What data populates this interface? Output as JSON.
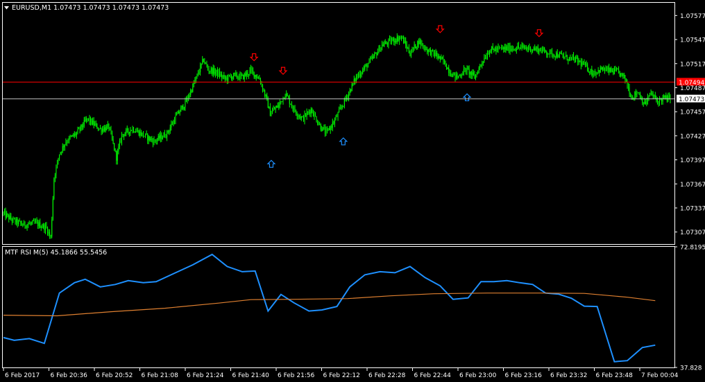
{
  "colors": {
    "background": "#000000",
    "foreground": "#ffffff",
    "bull": "#00ff00",
    "bear": "#00ff00",
    "bid_line": "#c0c0c0",
    "ask_line": "#ff0000",
    "rsi_fast": "#1e90ff",
    "rsi_slow": "#e08030",
    "sell_arrow": "#ff0000",
    "buy_arrow": "#1e90ff"
  },
  "header": {
    "symbol_line": "EURUSD,M1  1.07473 1.07473 1.07473 1.07473"
  },
  "indicator": {
    "label": "MTF RSI M(5) 45.1866 55.5456",
    "ymax_label": "72.8195",
    "ymin_label": "37.828"
  },
  "chart_data": [
    {
      "type": "candlestick",
      "symbol": "EURUSD",
      "timeframe": "M1",
      "ylim": [
        1.07292,
        1.07592
      ],
      "y_ticks": [
        "1.07577",
        "1.07547",
        "1.07517",
        "1.07487",
        "1.07457",
        "1.07427",
        "1.07397",
        "1.07367",
        "1.07337",
        "1.07307"
      ],
      "y_tick_values": [
        1.07577,
        1.07547,
        1.07517,
        1.07487,
        1.07457,
        1.07427,
        1.07397,
        1.07367,
        1.07337,
        1.07307
      ],
      "x_ticks": [
        "6 Feb 2017",
        "6 Feb 20:36",
        "6 Feb 20:52",
        "6 Feb 21:08",
        "6 Feb 21:24",
        "6 Feb 21:40",
        "6 Feb 21:56",
        "6 Feb 22:12",
        "6 Feb 22:28",
        "6 Feb 22:44",
        "6 Feb 23:00",
        "6 Feb 23:16",
        "6 Feb 23:32",
        "6 Feb 23:48",
        "7 Feb 00:04"
      ],
      "bid_price": 1.07473,
      "bid_label": "1.07473",
      "ask_price": 1.07494,
      "ask_label": "1.07494",
      "price_path": [
        [
          0,
          1.0733
        ],
        [
          8,
          1.07322
        ],
        [
          18,
          1.07316
        ],
        [
          30,
          1.07318
        ],
        [
          40,
          1.07312
        ],
        [
          44,
          1.073
        ],
        [
          47,
          1.07375
        ],
        [
          52,
          1.07405
        ],
        [
          58,
          1.0742
        ],
        [
          68,
          1.0743
        ],
        [
          78,
          1.07448
        ],
        [
          90,
          1.07435
        ],
        [
          98,
          1.07438
        ],
        [
          105,
          1.074
        ],
        [
          110,
          1.07428
        ],
        [
          120,
          1.07436
        ],
        [
          130,
          1.07428
        ],
        [
          140,
          1.0742
        ],
        [
          152,
          1.0743
        ],
        [
          160,
          1.0745
        ],
        [
          170,
          1.0747
        ],
        [
          178,
          1.07495
        ],
        [
          186,
          1.07522
        ],
        [
          190,
          1.0751
        ],
        [
          198,
          1.07506
        ],
        [
          206,
          1.07498
        ],
        [
          214,
          1.07502
        ],
        [
          222,
          1.075
        ],
        [
          230,
          1.07508
        ],
        [
          238,
          1.07498
        ],
        [
          244,
          1.07475
        ],
        [
          248,
          1.07455
        ],
        [
          256,
          1.07465
        ],
        [
          262,
          1.0748
        ],
        [
          270,
          1.0746
        ],
        [
          278,
          1.07448
        ],
        [
          286,
          1.0746
        ],
        [
          294,
          1.0744
        ],
        [
          300,
          1.0743
        ],
        [
          308,
          1.07446
        ],
        [
          314,
          1.07462
        ],
        [
          320,
          1.07478
        ],
        [
          328,
          1.075
        ],
        [
          336,
          1.07512
        ],
        [
          344,
          1.07525
        ],
        [
          352,
          1.0754
        ],
        [
          362,
          1.07546
        ],
        [
          370,
          1.0755
        ],
        [
          378,
          1.0753
        ],
        [
          386,
          1.07545
        ],
        [
          394,
          1.07534
        ],
        [
          402,
          1.07528
        ],
        [
          410,
          1.07518
        ],
        [
          416,
          1.07505
        ],
        [
          422,
          1.075
        ],
        [
          430,
          1.0751
        ],
        [
          438,
          1.075
        ],
        [
          446,
          1.07522
        ],
        [
          452,
          1.07534
        ],
        [
          460,
          1.07535
        ],
        [
          470,
          1.07536
        ],
        [
          480,
          1.07537
        ],
        [
          490,
          1.07536
        ],
        [
          500,
          1.07534
        ],
        [
          508,
          1.0753
        ],
        [
          516,
          1.07528
        ],
        [
          524,
          1.07524
        ],
        [
          532,
          1.07522
        ],
        [
          540,
          1.07515
        ],
        [
          548,
          1.07505
        ],
        [
          556,
          1.0751
        ],
        [
          564,
          1.07508
        ],
        [
          572,
          1.07506
        ],
        [
          578,
          1.07498
        ],
        [
          584,
          1.07475
        ],
        [
          590,
          1.07482
        ],
        [
          596,
          1.07466
        ],
        [
          602,
          1.0748
        ],
        [
          608,
          1.0747
        ],
        [
          614,
          1.07474
        ],
        [
          620,
          1.07473
        ]
      ],
      "sell_signals": [
        [
          233,
          1.07525
        ],
        [
          260,
          1.07508
        ],
        [
          406,
          1.0756
        ],
        [
          498,
          1.07555
        ]
      ],
      "buy_signals": [
        [
          249,
          1.07392
        ],
        [
          316,
          1.0742
        ],
        [
          431,
          1.07475
        ]
      ]
    },
    {
      "type": "line",
      "title": "MTF RSI M(5) 45.1866 55.5456",
      "ylim": [
        37.828,
        72.8195
      ],
      "y_ticks": [
        "72.8195",
        "37.828"
      ],
      "series": [
        {
          "values": [
            [
              0,
              46.5
            ],
            [
              10,
              45.7
            ],
            [
              24,
              46.2
            ],
            [
              38,
              44.8
            ],
            [
              52,
              59.4
            ],
            [
              66,
              62.4
            ],
            [
              76,
              63.4
            ],
            [
              90,
              61.2
            ],
            [
              104,
              61.9
            ],
            [
              116,
              63.0
            ],
            [
              130,
              62.4
            ],
            [
              142,
              62.7
            ],
            [
              160,
              65.3
            ],
            [
              176,
              67.6
            ],
            [
              194,
              70.6
            ],
            [
              208,
              67.1
            ],
            [
              222,
              65.6
            ],
            [
              234,
              65.8
            ],
            [
              246,
              54.2
            ],
            [
              258,
              59.0
            ],
            [
              270,
              56.6
            ],
            [
              284,
              54.2
            ],
            [
              296,
              54.5
            ],
            [
              310,
              55.5
            ],
            [
              322,
              61.2
            ],
            [
              336,
              64.7
            ],
            [
              350,
              65.6
            ],
            [
              364,
              65.3
            ],
            [
              378,
              67.1
            ],
            [
              392,
              63.9
            ],
            [
              406,
              61.5
            ],
            [
              418,
              57.6
            ],
            [
              432,
              58.0
            ],
            [
              444,
              62.7
            ],
            [
              456,
              62.7
            ],
            [
              468,
              63.0
            ],
            [
              480,
              62.4
            ],
            [
              492,
              61.9
            ],
            [
              504,
              59.4
            ],
            [
              516,
              59.1
            ],
            [
              528,
              57.9
            ],
            [
              540,
              55.6
            ],
            [
              552,
              55.5
            ],
            [
              568,
              39.5
            ],
            [
              580,
              39.8
            ],
            [
              594,
              43.6
            ],
            [
              606,
              44.3
            ]
          ]
        },
        {
          "values": [
            [
              0,
              53.0
            ],
            [
              50,
              52.8
            ],
            [
              100,
              54.0
            ],
            [
              150,
              55.0
            ],
            [
              200,
              56.5
            ],
            [
              230,
              57.5
            ],
            [
              270,
              57.6
            ],
            [
              320,
              57.8
            ],
            [
              360,
              58.6
            ],
            [
              400,
              59.2
            ],
            [
              450,
              59.4
            ],
            [
              500,
              59.4
            ],
            [
              540,
              59.3
            ],
            [
              580,
              58.2
            ],
            [
              606,
              57.2
            ]
          ]
        }
      ]
    }
  ]
}
